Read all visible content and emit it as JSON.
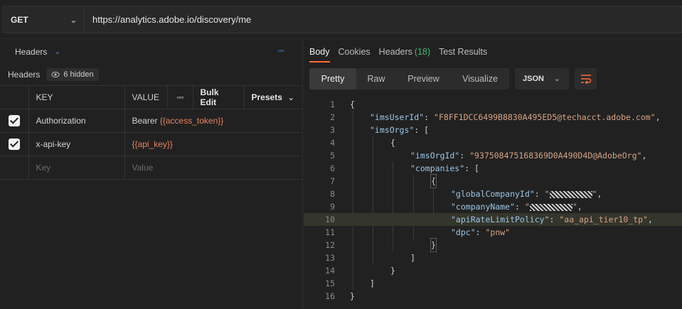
{
  "request": {
    "method": "GET",
    "url": "https://analytics.adobe.io/discovery/me"
  },
  "left_panel": {
    "tab_label": "Headers",
    "section_label": "Headers",
    "hidden_badge": "6 hidden",
    "columns": {
      "key": "KEY",
      "value": "VALUE",
      "bulk_edit": "Bulk Edit",
      "presets": "Presets"
    },
    "rows": [
      {
        "key": "Authorization",
        "value_prefix": "Bearer ",
        "value_var": "{{access_token}}",
        "checked": true
      },
      {
        "key": "x-api-key",
        "value_prefix": "",
        "value_var": "{{api_key}}",
        "checked": true
      }
    ],
    "placeholder_row": {
      "key": "Key",
      "value": "Value"
    }
  },
  "response": {
    "tabs": {
      "body": "Body",
      "cookies": "Cookies",
      "headers": "Headers",
      "headers_count": "(18)",
      "test_results": "Test Results"
    },
    "view_modes": [
      "Pretty",
      "Raw",
      "Preview",
      "Visualize"
    ],
    "active_view": "Pretty",
    "format": "JSON",
    "lines": [
      {
        "n": "1",
        "text": "{"
      },
      {
        "n": "2",
        "key": "\"imsUserId\"",
        "sep": ": ",
        "val": "\"F8FF1DCC6499B8830A495ED5@techacct.adobe.com\"",
        "tail": ","
      },
      {
        "n": "3",
        "key": "\"imsOrgs\"",
        "sep": ": ",
        "tail": "["
      },
      {
        "n": "4",
        "text": "{"
      },
      {
        "n": "5",
        "key": "\"imsOrgId\"",
        "sep": ": ",
        "val": "\"937508475168369D0A490D4D@AdobeOrg\"",
        "tail": ","
      },
      {
        "n": "6",
        "key": "\"companies\"",
        "sep": ": ",
        "tail": "["
      },
      {
        "n": "7",
        "text": "{"
      },
      {
        "n": "8",
        "key": "\"globalCompanyId\"",
        "sep": ": ",
        "val": "\"",
        "tail": ","
      },
      {
        "n": "9",
        "key": "\"companyName\"",
        "sep": ": ",
        "val": "\"",
        "tail": ","
      },
      {
        "n": "10",
        "key": "\"apiRateLimitPolicy\"",
        "sep": ": ",
        "val": "\"aa_api_tier10_tp\"",
        "tail": ","
      },
      {
        "n": "11",
        "key": "\"dpc\"",
        "sep": ": ",
        "val": "\"pnw\""
      },
      {
        "n": "12",
        "text": "}"
      },
      {
        "n": "13",
        "text": "]"
      },
      {
        "n": "14",
        "text": "}"
      },
      {
        "n": "15",
        "text": "]"
      },
      {
        "n": "16",
        "text": "}"
      }
    ]
  },
  "colors": {
    "accent": "#ff6c37",
    "json_key": "#9cc7e8",
    "json_string": "#d7a388",
    "variable": "#e8825e",
    "count_green": "#49b86b"
  }
}
